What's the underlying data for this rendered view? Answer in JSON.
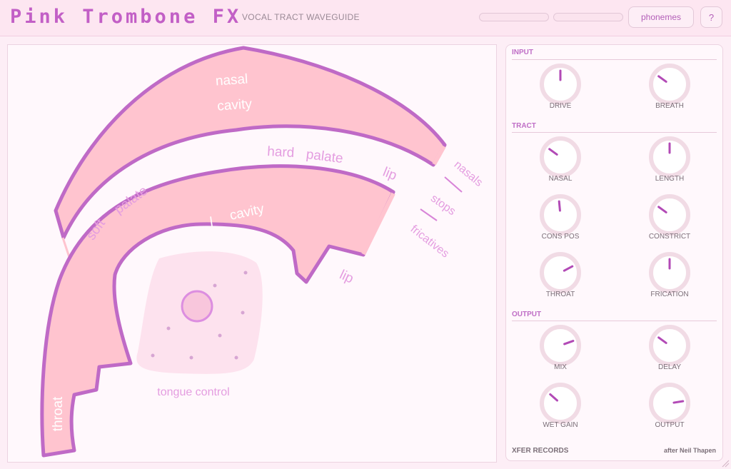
{
  "header": {
    "title": "Pink Trombone FX",
    "subtitle": "VOCAL TRACT WAVEGUIDE",
    "phonemes_button": "phonemes",
    "help_button": "?"
  },
  "tract": {
    "labels": {
      "nasal": "nasal",
      "cavity_top": "cavity",
      "hard": "hard",
      "palate": "palate",
      "lip_upper": "lip",
      "soft": "soft",
      "soft_palate": "palate",
      "oral": "l",
      "oral_cavity": "cavity",
      "nasals": "nasals",
      "stops": "stops",
      "fricatives": "fricatives",
      "lip_lower": "lip",
      "throat": "throat",
      "tongue_control": "tongue control"
    }
  },
  "sections": {
    "input": "INPUT",
    "tract": "TRACT",
    "output": "OUTPUT"
  },
  "knobs": {
    "drive": {
      "label": "DRIVE",
      "value": 0.5
    },
    "breath": {
      "label": "BREATH",
      "value": 0.3
    },
    "nasal": {
      "label": "NASAL",
      "value": 0.3
    },
    "length": {
      "label": "LENGTH",
      "value": 0.5
    },
    "cons_pos": {
      "label": "CONS POS",
      "value": 0.48
    },
    "constrict": {
      "label": "CONSTRICT",
      "value": 0.3
    },
    "throat": {
      "label": "THROAT",
      "value": 0.73
    },
    "frication": {
      "label": "FRICATION",
      "value": 0.5
    },
    "mix": {
      "label": "MIX",
      "value": 0.76
    },
    "delay": {
      "label": "DELAY",
      "value": 0.3
    },
    "wet_gain": {
      "label": "WET GAIN",
      "value": 0.32
    },
    "output": {
      "label": "OUTPUT",
      "value": 0.8
    }
  },
  "footer": {
    "brand": "XFER RECORDS",
    "credit": "after Neil Thapen"
  },
  "colors": {
    "accent": "#c25fc6",
    "tract_fill": "#ffc4cf",
    "tract_outline": "#bf6ac6",
    "label_pink": "#e49de0",
    "knob_ring": "#f1dbe5",
    "knob_indicator": "#b24ab6"
  }
}
